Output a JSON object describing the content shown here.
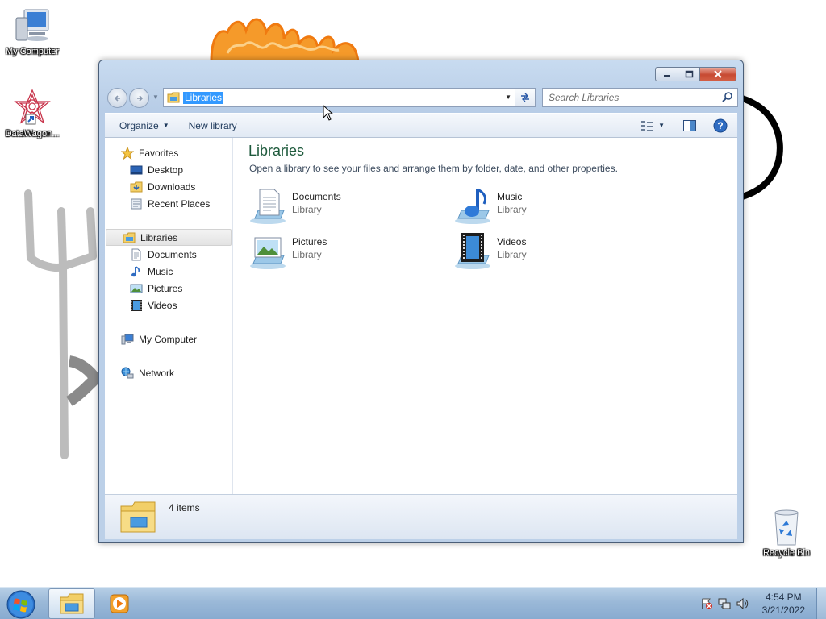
{
  "desktop": {
    "icons": [
      {
        "label": "My Computer",
        "icon": "my-computer-icon"
      },
      {
        "label": "DataWagon...",
        "icon": "datawagon-shortcut-icon"
      },
      {
        "label": "Recycle Bin",
        "icon": "recycle-bin-icon"
      }
    ]
  },
  "window": {
    "address": "Libraries",
    "search_placeholder": "Search Libraries",
    "toolbar": {
      "organize_label": "Organize",
      "new_library_label": "New library"
    },
    "nav_pane": {
      "items": [
        {
          "label": "Favorites",
          "icon": "star-icon"
        },
        {
          "label": "Desktop",
          "icon": "desktop-icon"
        },
        {
          "label": "Downloads",
          "icon": "downloads-icon"
        },
        {
          "label": "Recent Places",
          "icon": "recent-places-icon"
        },
        {
          "label": "Libraries",
          "icon": "libraries-icon"
        },
        {
          "label": "Documents",
          "icon": "documents-icon"
        },
        {
          "label": "Music",
          "icon": "music-icon"
        },
        {
          "label": "Pictures",
          "icon": "pictures-icon"
        },
        {
          "label": "Videos",
          "icon": "videos-icon"
        },
        {
          "label": "My Computer",
          "icon": "computer-icon"
        },
        {
          "label": "Network",
          "icon": "network-icon"
        }
      ]
    },
    "content": {
      "title": "Libraries",
      "subtitle": "Open a library to see your files and arrange them by folder, date, and other properties.",
      "libraries": [
        {
          "name": "Documents",
          "type": "Library",
          "icon": "documents-library-icon"
        },
        {
          "name": "Music",
          "type": "Library",
          "icon": "music-library-icon"
        },
        {
          "name": "Pictures",
          "type": "Library",
          "icon": "pictures-library-icon"
        },
        {
          "name": "Videos",
          "type": "Library",
          "icon": "videos-library-icon"
        }
      ]
    },
    "details": {
      "item_count": "4 items"
    }
  },
  "taskbar": {
    "clock_time": "4:54 PM",
    "clock_date": "3/21/2022"
  },
  "colors": {
    "title_green": "#1e5a3c",
    "selection_blue": "#3399ff",
    "close_red": "#c74a32"
  }
}
